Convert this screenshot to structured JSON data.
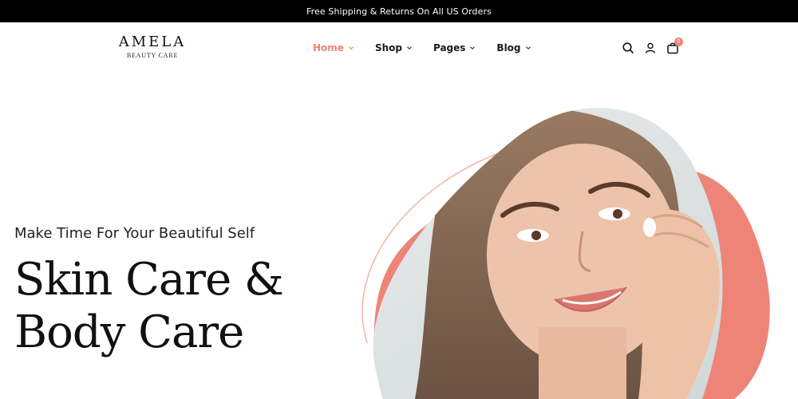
{
  "announcement": "Free Shipping & Returns On All US Orders",
  "brand": {
    "name": "AMELA",
    "sub": "BEAUTY CARE"
  },
  "nav": [
    {
      "label": "Home",
      "active": true
    },
    {
      "label": "Shop",
      "active": false
    },
    {
      "label": "Pages",
      "active": false
    },
    {
      "label": "Blog",
      "active": false
    }
  ],
  "header_icons": [
    "search-icon",
    "user-icon",
    "cart-icon"
  ],
  "cart_count": "0",
  "hero": {
    "tagline": "Make Time For Your Beautiful Self",
    "headline_line1": "Skin Care &",
    "headline_line2": "Body Care"
  },
  "colors": {
    "accent": "#ee8478",
    "topbar": "#000000",
    "text": "#111111"
  }
}
